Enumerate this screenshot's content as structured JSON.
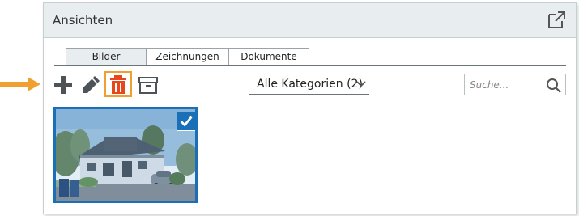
{
  "panel": {
    "title": "Ansichten",
    "popout_icon": "external-link-icon"
  },
  "tabs": [
    {
      "label": "Bilder",
      "active": true
    },
    {
      "label": "Zeichnungen",
      "active": false
    },
    {
      "label": "Dokumente",
      "active": false
    }
  ],
  "toolbar": {
    "add_icon": "plus-icon",
    "edit_icon": "pencil-icon",
    "delete_icon": "trash-icon",
    "archive_icon": "archive-box-icon",
    "delete_highlight_color": "#f0a030",
    "delete_icon_color": "#e8461c"
  },
  "category_filter": {
    "selected": "Alle Kategorien (2)"
  },
  "search": {
    "placeholder": "Suche..."
  },
  "images": [
    {
      "selected": true
    }
  ],
  "colors": {
    "accent": "#1a6fb7",
    "header_bg": "#e8eef0",
    "pointer_arrow": "#f0a030"
  }
}
